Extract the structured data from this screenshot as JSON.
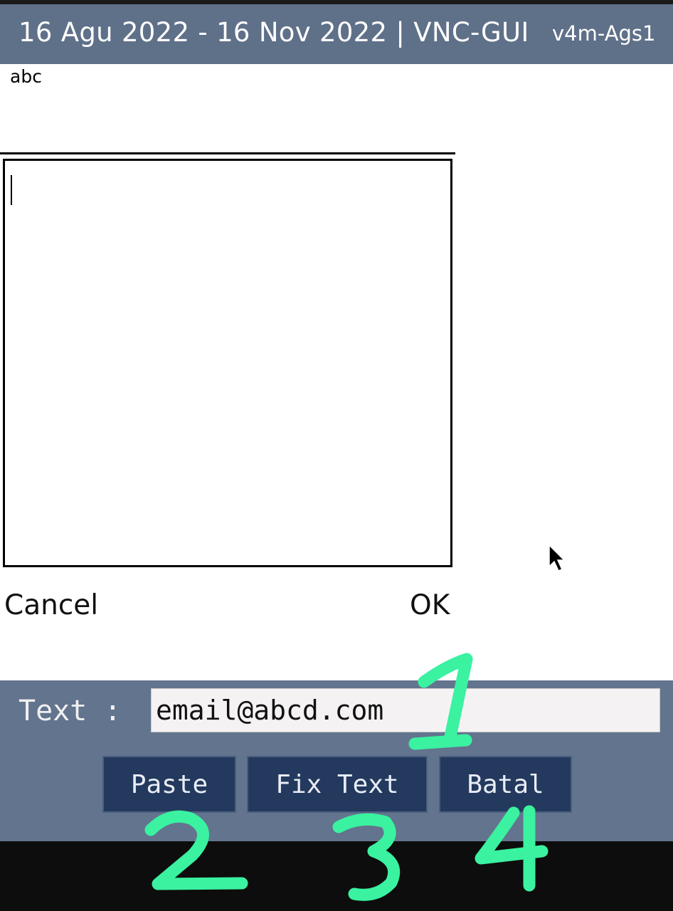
{
  "titlebar": {
    "title": "16 Agu 2022 - 16 Nov 2022 | VNC-GUI",
    "version": "v4m-Ags1"
  },
  "dialog": {
    "label": "abc",
    "textarea_value": "",
    "cancel_label": "Cancel",
    "ok_label": "OK"
  },
  "panel": {
    "text_label": "Text :",
    "text_value": "email@abcd.com",
    "paste_label": "Paste",
    "fix_label": "Fix Text",
    "batal_label": "Batal"
  },
  "annotations": [
    "1",
    "2",
    "3",
    "4"
  ],
  "colors": {
    "titlebar_bg": "#5f7089",
    "panel_bg": "#63748e",
    "button_bg": "#24395e",
    "annotation": "#3af2a0"
  }
}
